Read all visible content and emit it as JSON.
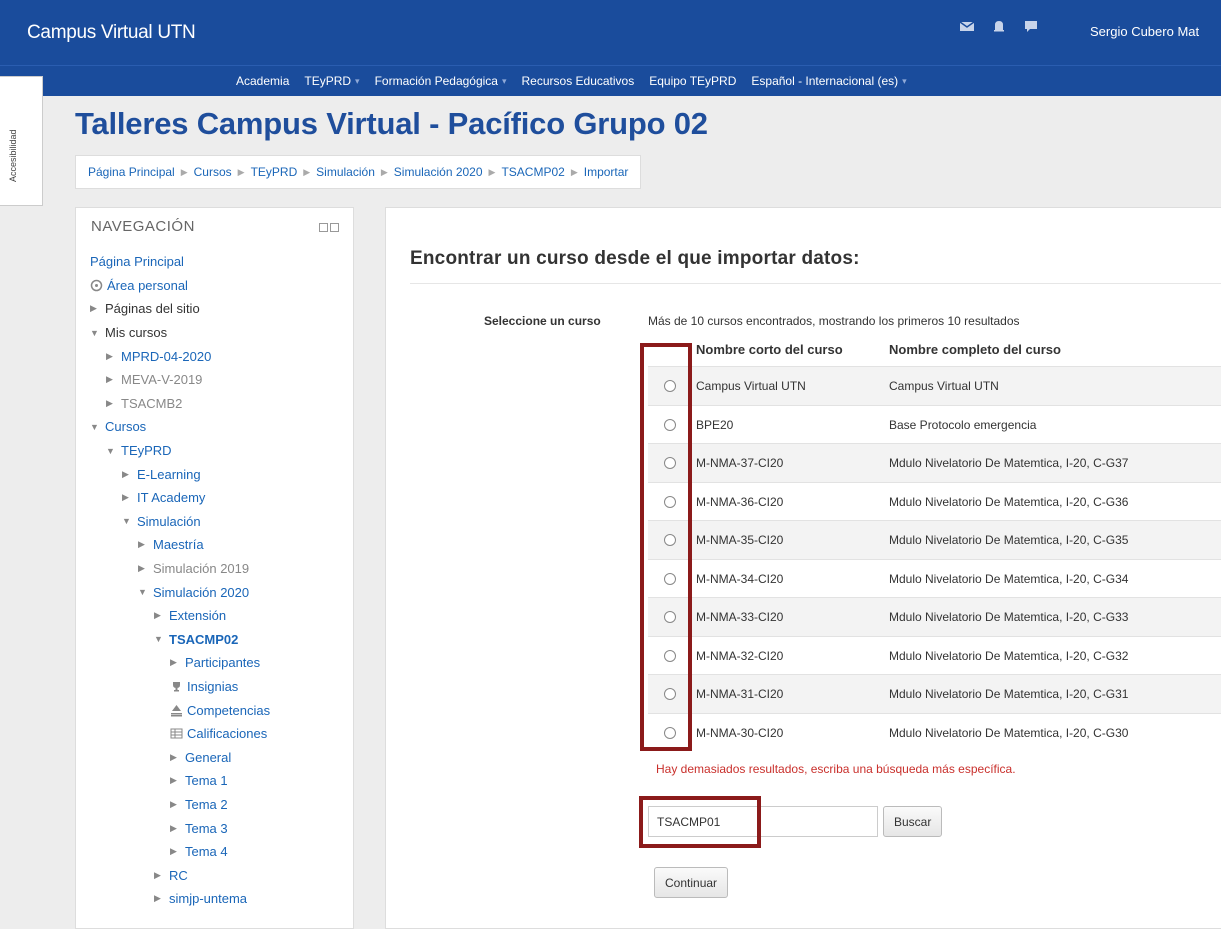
{
  "topbar": {
    "brand": "Campus Virtual UTN",
    "icons": [
      "mail-icon",
      "bell-icon",
      "chat-icon"
    ],
    "user_name": "Sergio Cubero Mat"
  },
  "menu": {
    "items": [
      {
        "label": "Academia",
        "dropdown": false
      },
      {
        "label": "TEyPRD",
        "dropdown": true
      },
      {
        "label": "Formación Pedagógica",
        "dropdown": true
      },
      {
        "label": "Recursos Educativos",
        "dropdown": false
      },
      {
        "label": "Equipo TEyPRD",
        "dropdown": false
      },
      {
        "label": "Español - Internacional (es)",
        "dropdown": true
      }
    ]
  },
  "accessibility": {
    "label": "Accesibilidad"
  },
  "page": {
    "title": "Talleres Campus Virtual - Pacífico Grupo 02"
  },
  "breadcrumb": [
    "Página Principal",
    "Cursos",
    "TEyPRD",
    "Simulación",
    "Simulación 2020",
    "TSACMP02",
    "Importar"
  ],
  "navigation": {
    "title": "NAVEGACIÓN",
    "items": [
      {
        "label": "Página Principal",
        "toggle": "",
        "icon": "",
        "style": "link"
      },
      {
        "label": "Área personal",
        "toggle": "",
        "icon": "dashboard-icon",
        "style": "link"
      },
      {
        "label": "Páginas del sitio",
        "toggle": "▶",
        "icon": "",
        "style": "text"
      },
      {
        "label": "Mis cursos",
        "toggle": "▼",
        "icon": "",
        "style": "text"
      },
      {
        "label": "MPRD-04-2020",
        "toggle": "▶",
        "icon": "",
        "style": "link"
      },
      {
        "label": "MEVA-V-2019",
        "toggle": "▶",
        "icon": "",
        "style": "grey"
      },
      {
        "label": "TSACMB2",
        "toggle": "▶",
        "icon": "",
        "style": "grey"
      },
      {
        "label": "Cursos",
        "toggle": "▼",
        "icon": "",
        "style": "link"
      },
      {
        "label": "TEyPRD",
        "toggle": "▼",
        "icon": "",
        "style": "link"
      },
      {
        "label": "E-Learning",
        "toggle": "▶",
        "icon": "",
        "style": "link"
      },
      {
        "label": "IT Academy",
        "toggle": "▶",
        "icon": "",
        "style": "link"
      },
      {
        "label": "Simulación",
        "toggle": "▼",
        "icon": "",
        "style": "link"
      },
      {
        "label": "Maestría",
        "toggle": "▶",
        "icon": "",
        "style": "link"
      },
      {
        "label": "Simulación 2019",
        "toggle": "▶",
        "icon": "",
        "style": "grey"
      },
      {
        "label": "Simulación 2020",
        "toggle": "▼",
        "icon": "",
        "style": "link"
      },
      {
        "label": "Extensión",
        "toggle": "▶",
        "icon": "",
        "style": "link"
      },
      {
        "label": "TSACMP02",
        "toggle": "▼",
        "icon": "",
        "style": "bold-link"
      },
      {
        "label": "Participantes",
        "toggle": "▶",
        "icon": "",
        "style": "link"
      },
      {
        "label": "Insignias",
        "toggle": "",
        "icon": "trophy-icon",
        "style": "link"
      },
      {
        "label": "Competencias",
        "toggle": "",
        "icon": "competency-icon",
        "style": "link"
      },
      {
        "label": "Calificaciones",
        "toggle": "",
        "icon": "grades-table-icon",
        "style": "link"
      },
      {
        "label": "General",
        "toggle": "▶",
        "icon": "",
        "style": "link"
      },
      {
        "label": "Tema 1",
        "toggle": "▶",
        "icon": "",
        "style": "link"
      },
      {
        "label": "Tema 2",
        "toggle": "▶",
        "icon": "",
        "style": "link"
      },
      {
        "label": "Tema 3",
        "toggle": "▶",
        "icon": "",
        "style": "link"
      },
      {
        "label": "Tema 4",
        "toggle": "▶",
        "icon": "",
        "style": "link"
      },
      {
        "label": "RC",
        "toggle": "▶",
        "icon": "",
        "style": "link"
      },
      {
        "label": "simjp-untema",
        "toggle": "▶",
        "icon": "",
        "style": "link"
      }
    ]
  },
  "import": {
    "heading": "Encontrar un curso desde el que importar datos:",
    "select_label": "Seleccione un curso",
    "results_info": "Más de 10 cursos encontrados, mostrando los primeros 10 resultados",
    "columns": {
      "short": "Nombre corto del curso",
      "full": "Nombre completo del curso"
    },
    "rows": [
      {
        "short": "Campus Virtual UTN",
        "full": "Campus Virtual UTN"
      },
      {
        "short": "BPE20",
        "full": "Base Protocolo emergencia"
      },
      {
        "short": "M-NMA-37-CI20",
        "full": "Mdulo Nivelatorio De Matemtica, I-20, C-G37"
      },
      {
        "short": "M-NMA-36-CI20",
        "full": "Mdulo Nivelatorio De Matemtica, I-20, C-G36"
      },
      {
        "short": "M-NMA-35-CI20",
        "full": "Mdulo Nivelatorio De Matemtica, I-20, C-G35"
      },
      {
        "short": "M-NMA-34-CI20",
        "full": "Mdulo Nivelatorio De Matemtica, I-20, C-G34"
      },
      {
        "short": "M-NMA-33-CI20",
        "full": "Mdulo Nivelatorio De Matemtica, I-20, C-G33"
      },
      {
        "short": "M-NMA-32-CI20",
        "full": "Mdulo Nivelatorio De Matemtica, I-20, C-G32"
      },
      {
        "short": "M-NMA-31-CI20",
        "full": "Mdulo Nivelatorio De Matemtica, I-20, C-G31"
      },
      {
        "short": "M-NMA-30-CI20",
        "full": "Mdulo Nivelatorio De Matemtica, I-20, C-G30"
      }
    ],
    "warning": "Hay demasiados resultados, escriba una búsqueda más específica.",
    "search_value": "TSACMP01",
    "search_button": "Buscar",
    "continue_button": "Continuar"
  },
  "colors": {
    "navbar": "#1a4c9c",
    "title": "#1f4e9c",
    "link": "#1a66b8",
    "warning": "#c9302c",
    "highlight": "#8b1a1a"
  }
}
